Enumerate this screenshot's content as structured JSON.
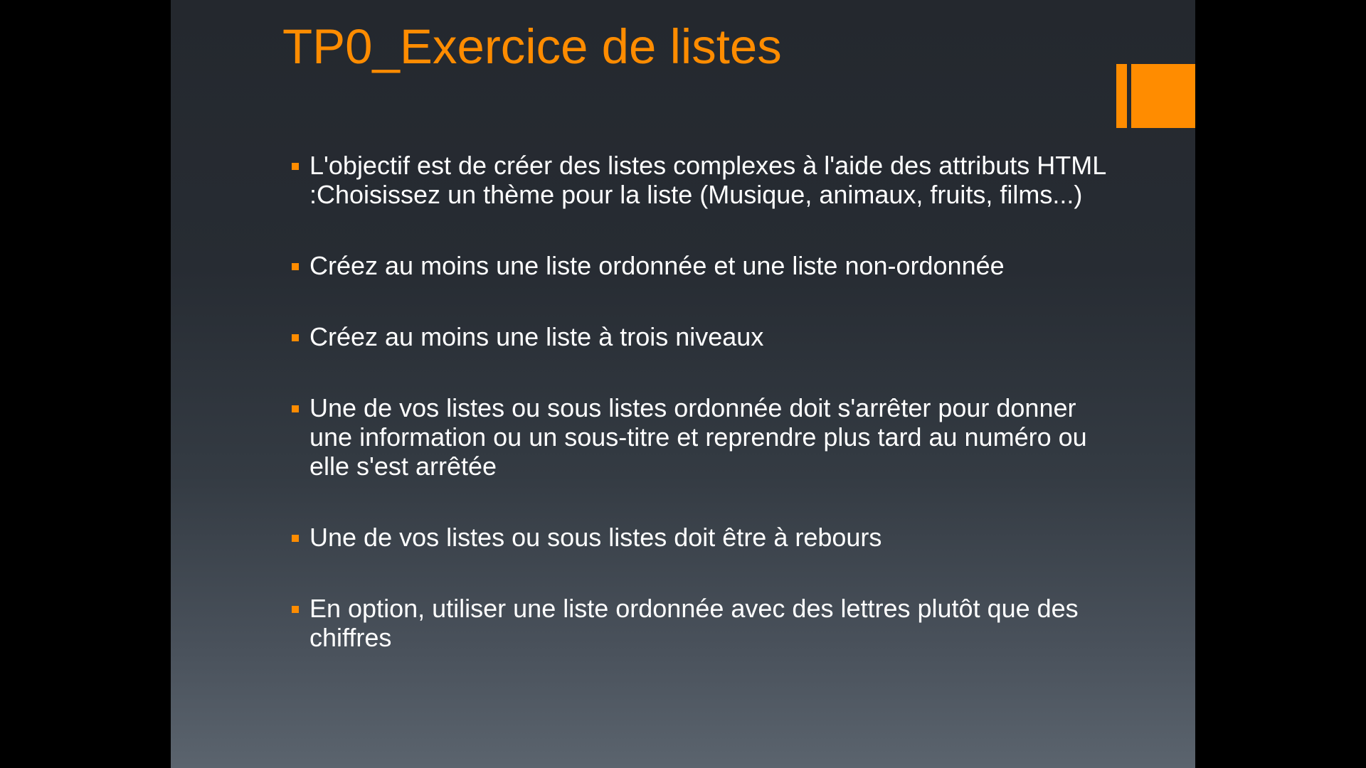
{
  "slide": {
    "title": "TP0_Exercice de listes",
    "accent_color": "#ff8c00",
    "bullets": [
      "L'objectif est de créer des listes complexes à l'aide des attributs HTML :Choisissez un thème pour la liste (Musique, animaux, fruits, films...)",
      "Créez au moins une liste ordonnée et une liste non-ordonnée",
      "Créez au moins une liste à trois niveaux",
      "Une de vos listes ou sous listes ordonnée doit s'arrêter pour donner une information ou un sous-titre et reprendre plus tard au numéro ou elle s'est arrêtée",
      "Une de vos listes ou sous listes doit être à rebours",
      "En option, utiliser une liste ordonnée avec des lettres plutôt que des chiffres"
    ]
  }
}
